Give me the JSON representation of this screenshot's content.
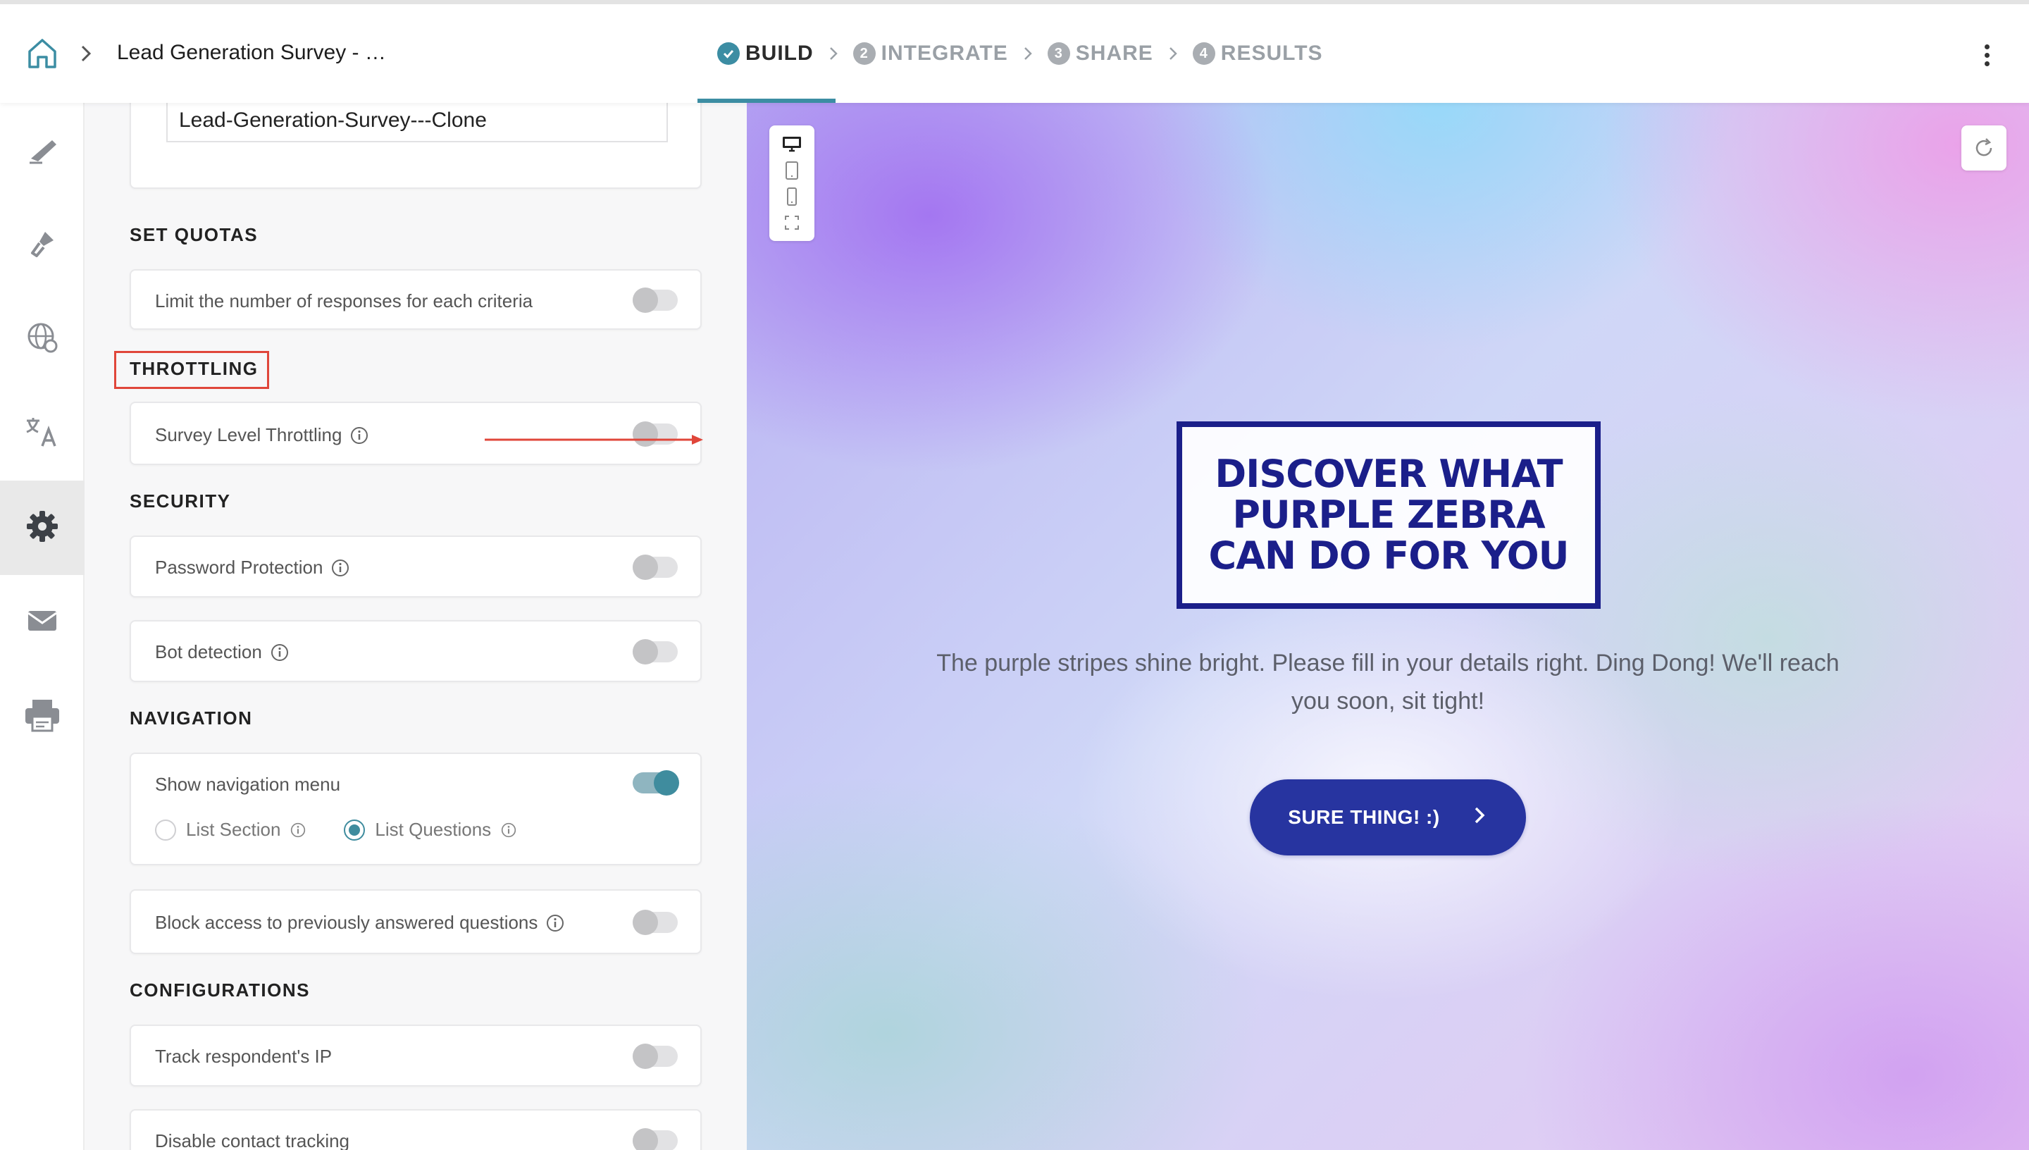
{
  "header": {
    "survey_title": "Lead Generation Survey - …",
    "steps": [
      {
        "num": "",
        "label": "BUILD",
        "state": "done"
      },
      {
        "num": "2",
        "label": "INTEGRATE",
        "state": "pending"
      },
      {
        "num": "3",
        "label": "SHARE",
        "state": "pending"
      },
      {
        "num": "4",
        "label": "RESULTS",
        "state": "pending"
      }
    ]
  },
  "sidebar": {
    "items": [
      {
        "icon": "pencil-icon"
      },
      {
        "icon": "paint-brush-icon"
      },
      {
        "icon": "globe-icon"
      },
      {
        "icon": "translate-icon"
      },
      {
        "icon": "gear-icon",
        "active": true
      },
      {
        "icon": "mail-icon"
      },
      {
        "icon": "print-icon"
      }
    ]
  },
  "settings": {
    "survey_name_value": "Lead-Generation-Survey---Clone",
    "quotas": {
      "heading": "SET QUOTAS",
      "limit_label": "Limit the number of responses for each criteria",
      "limit_on": false
    },
    "throttling": {
      "heading": "THROTTLING",
      "survey_level_label": "Survey Level Throttling",
      "survey_level_on": false
    },
    "security": {
      "heading": "SECURITY",
      "password_label": "Password Protection",
      "password_on": false,
      "bot_label": "Bot detection",
      "bot_on": false
    },
    "navigation": {
      "heading": "NAVIGATION",
      "show_menu_label": "Show navigation menu",
      "show_menu_on": true,
      "option_section": "List Section",
      "option_questions": "List Questions",
      "selected": "List Questions",
      "block_label": "Block access to previously answered questions",
      "block_on": false
    },
    "configurations": {
      "heading": "CONFIGURATIONS",
      "track_ip_label": "Track respondent's IP",
      "track_ip_on": false,
      "disable_contact_label": "Disable contact tracking",
      "disable_contact_on": false
    }
  },
  "preview": {
    "logo_lines": [
      "DISCOVER WHAT",
      "PURPLE ZEBRA",
      "CAN DO FOR YOU"
    ],
    "welcome_text": "The purple stripes shine bright. Please fill in your details right. Ding Dong! We'll reach you soon, sit tight!",
    "cta_label": "SURE THING! :)"
  },
  "colors": {
    "accent": "#3f8c9e",
    "cta": "#2734a0",
    "logo": "#1b1f8a",
    "highlight": "#e0463a"
  }
}
